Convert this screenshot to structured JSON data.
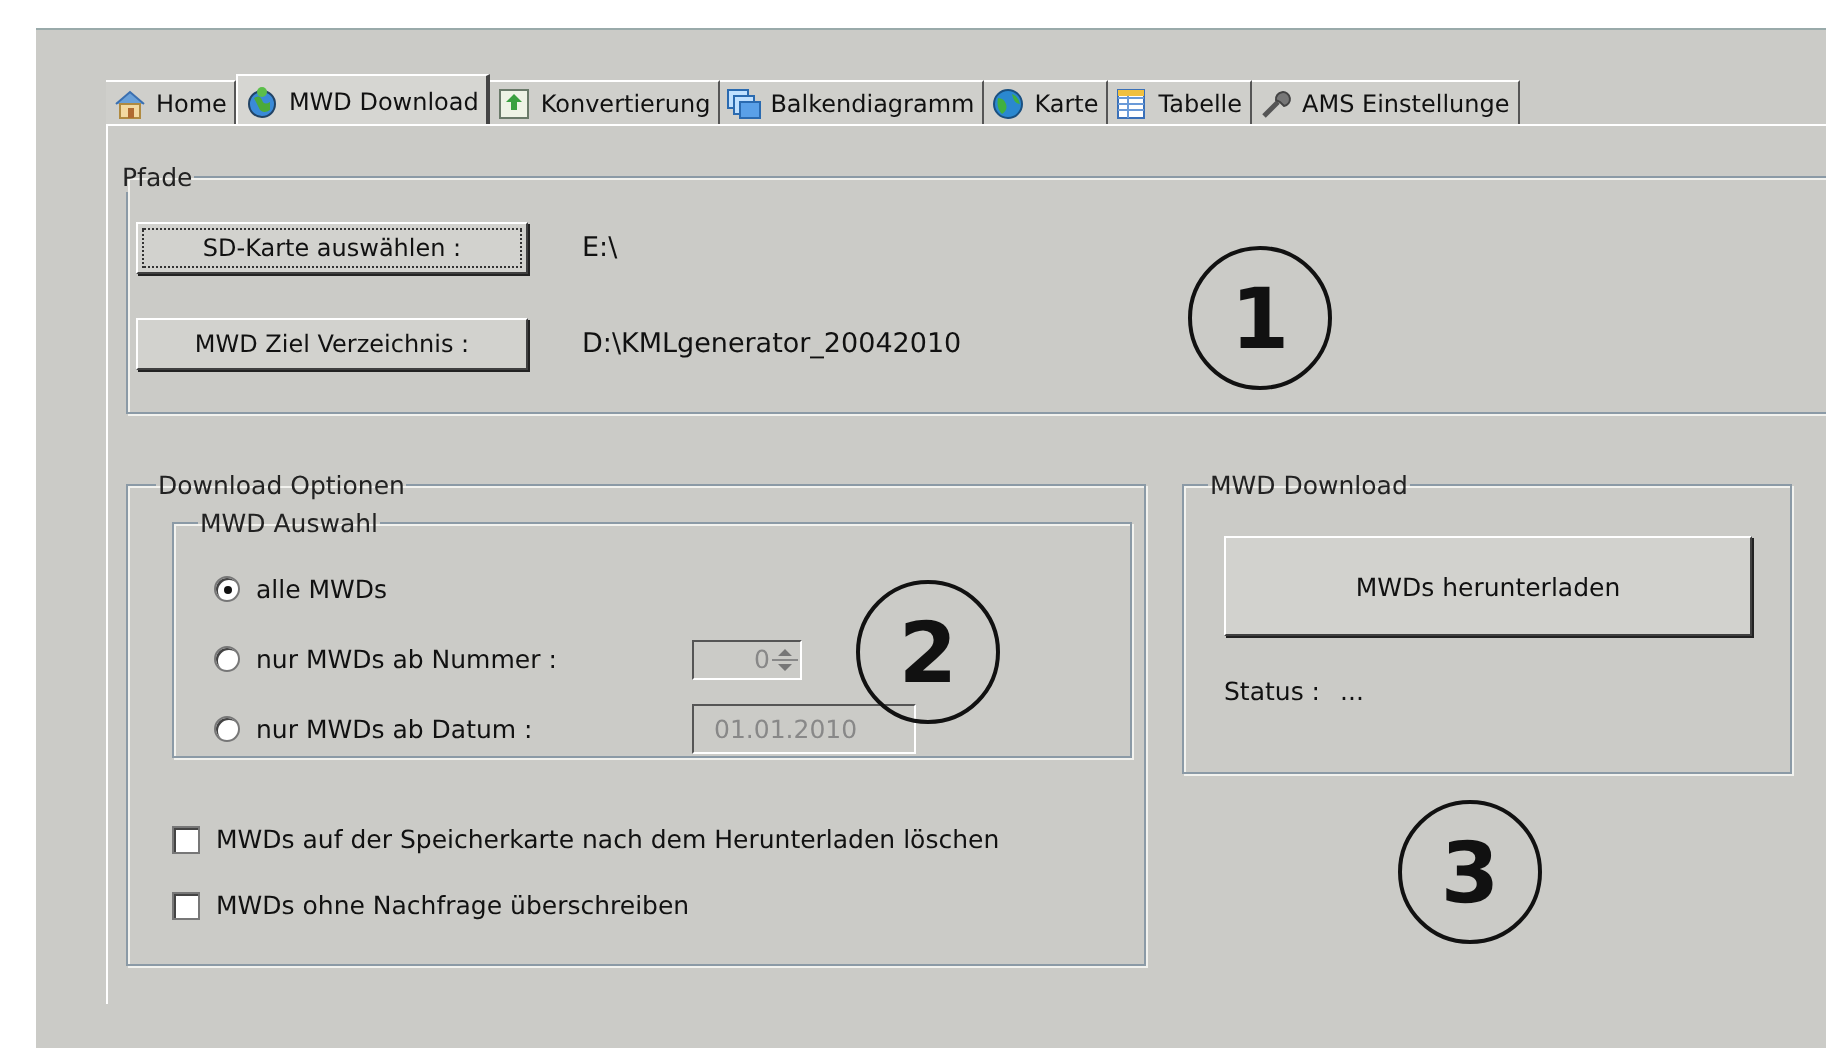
{
  "tabs": [
    {
      "label": "Home",
      "selected": false
    },
    {
      "label": "MWD Download",
      "selected": true
    },
    {
      "label": "Konvertierung",
      "selected": false
    },
    {
      "label": "Balkendiagramm",
      "selected": false
    },
    {
      "label": "Karte",
      "selected": false
    },
    {
      "label": "Tabelle",
      "selected": false
    },
    {
      "label": "AMS Einstellunge",
      "selected": false
    }
  ],
  "paths": {
    "title": "Pfade",
    "rows": [
      {
        "button": "SD-Karte auswählen :",
        "focused": true,
        "value": "E:\\"
      },
      {
        "button": "MWD Ziel Verzeichnis :",
        "focused": false,
        "value": "D:\\KMLgenerator_20042010"
      }
    ]
  },
  "download_options": {
    "title": "Download Optionen",
    "selection": {
      "title": "MWD Auswahl",
      "options": [
        {
          "kind": "plain",
          "label": "alle MWDs",
          "selected": true
        },
        {
          "kind": "spin",
          "label": "nur MWDs ab Nummer :",
          "selected": false,
          "value": "0",
          "disabled": true
        },
        {
          "kind": "date",
          "label": "nur MWDs ab Datum :",
          "selected": false,
          "value": "01.01.2010",
          "disabled": true
        }
      ]
    },
    "checkboxes": [
      {
        "label": "MWDs auf der Speicherkarte nach dem Herunterladen löschen",
        "checked": false
      },
      {
        "label": "MWDs ohne Nachfrage überschreiben",
        "checked": false
      }
    ]
  },
  "download": {
    "title": "MWD Download",
    "button": "MWDs herunterladen",
    "status_label": "Status :",
    "status_value": "..."
  },
  "callouts": [
    "1",
    "2",
    "3"
  ]
}
